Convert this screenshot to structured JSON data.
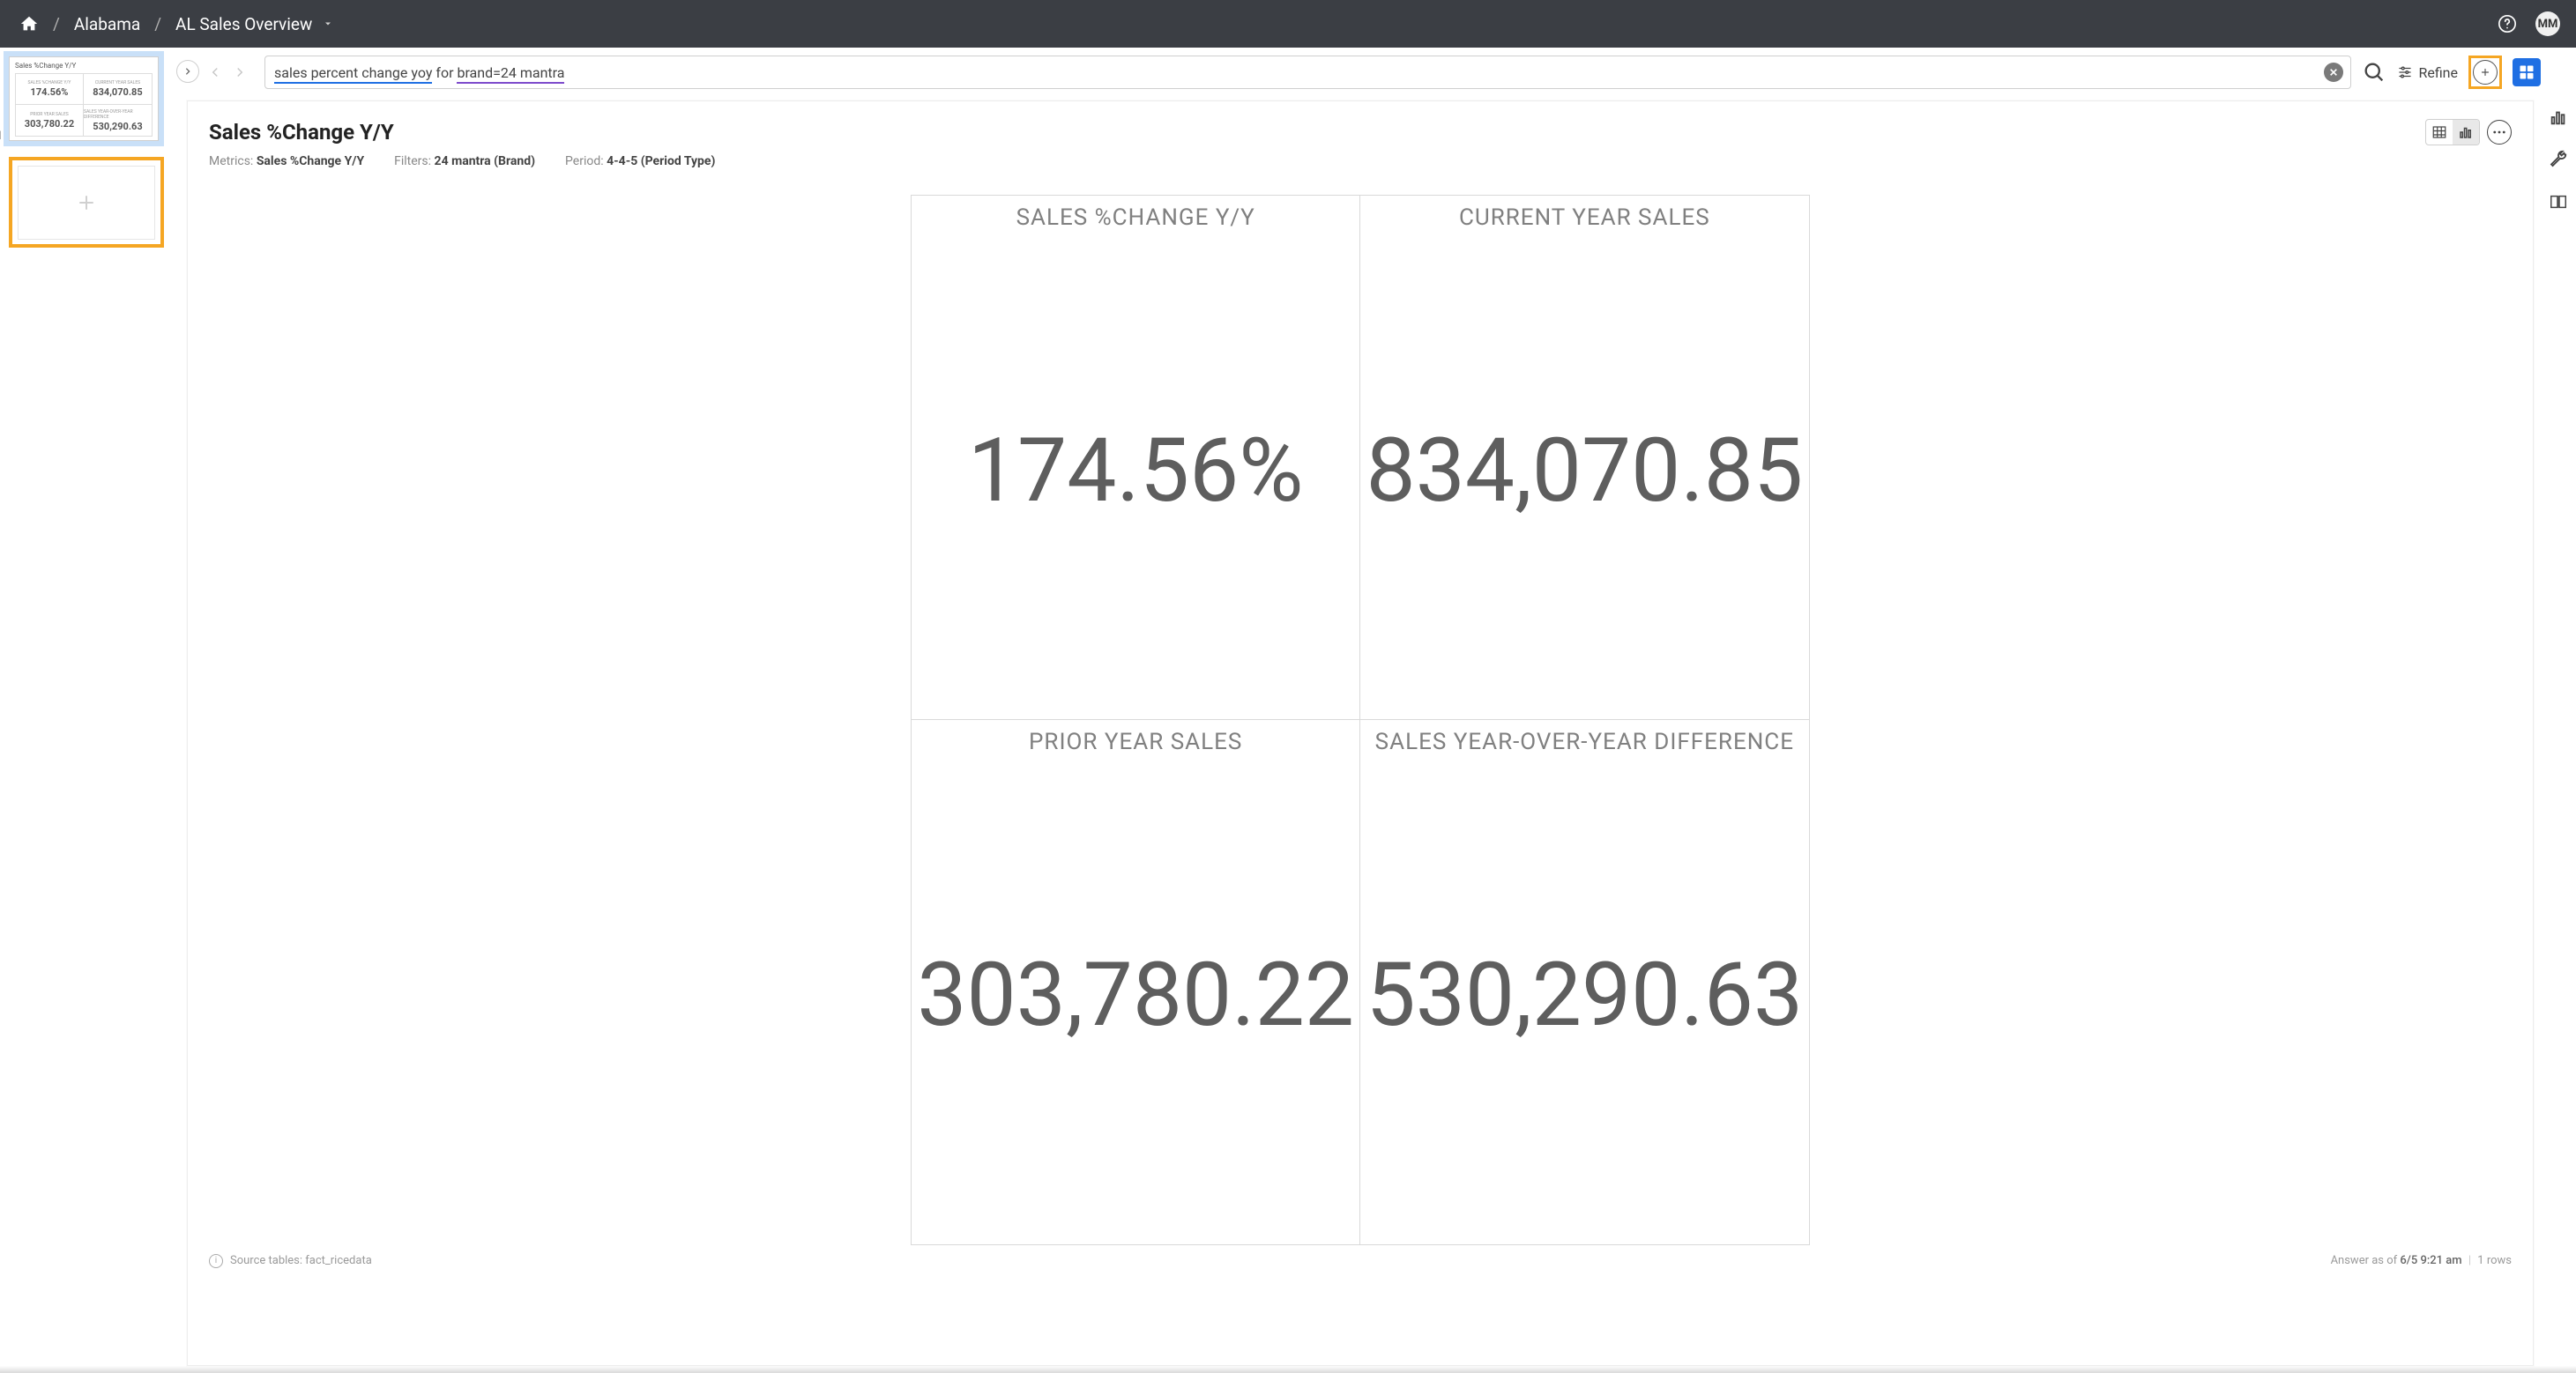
{
  "breadcrumbs": {
    "level1": "Alabama",
    "level2": "AL Sales Overview"
  },
  "header": {
    "avatar_initials": "MM"
  },
  "search": {
    "seg_metric": "sales percent change yoy",
    "seg_for": " for ",
    "seg_filter": "brand=24 mantra"
  },
  "refine_label": "Refine",
  "thumb": {
    "num": "1",
    "title": "Sales %Change Y/Y",
    "c0_lbl": "SALES %CHANGE Y/Y",
    "c0_val": "174.56%",
    "c1_lbl": "CURRENT YEAR SALES",
    "c1_val": "834,070.85",
    "c2_lbl": "PRIOR YEAR SALES",
    "c2_val": "303,780.22",
    "c3_lbl": "SALES YEAR-OVER-YEAR DIFFERENCE",
    "c3_val": "530,290.63"
  },
  "card": {
    "title": "Sales %Change Y/Y",
    "metrics_lbl": "Metrics:",
    "metrics_val": "Sales %Change Y/Y",
    "filters_lbl": "Filters:",
    "filters_val": "24 mantra (Brand)",
    "period_lbl": "Period:",
    "period_val": "4-4-5 (Period Type)",
    "cells": {
      "c0_hdr": "SALES %CHANGE Y/Y",
      "c0_val": "174.56%",
      "c1_hdr": "CURRENT YEAR SALES",
      "c1_val": "834,070.85",
      "c2_hdr": "PRIOR YEAR SALES",
      "c2_val": "303,780.22",
      "c3_hdr": "SALES YEAR-OVER-YEAR DIFFERENCE",
      "c3_val": "530,290.63"
    },
    "footer_src": "Source tables: fact_ricedata",
    "footer_answer_as_of_lbl": "Answer as of ",
    "footer_answer_as_of_val": "6/5 9:21 am",
    "footer_rows": "1 rows"
  }
}
